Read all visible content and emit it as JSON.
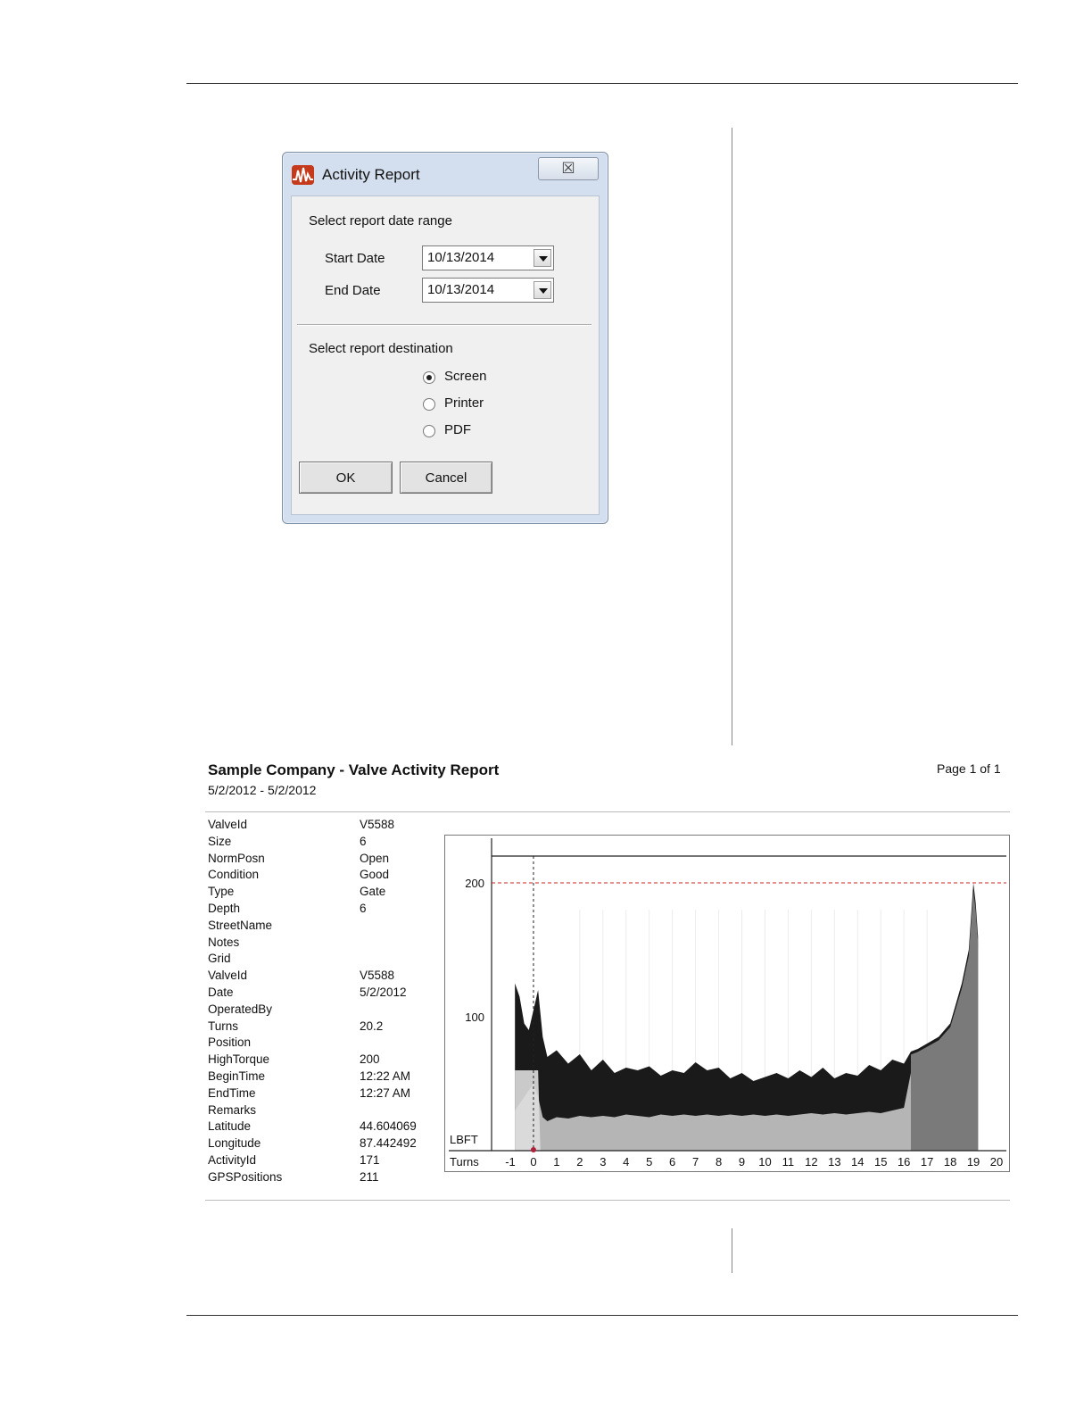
{
  "dialog": {
    "title": "Activity Report",
    "close_glyph": "☒",
    "date_section_label": "Select report date range",
    "start_date_label": "Start Date",
    "start_date_value": "10/13/2014",
    "end_date_label": "End Date",
    "end_date_value": "10/13/2014",
    "destination_section_label": "Select report destination",
    "destinations": [
      {
        "label": "Screen",
        "selected": true
      },
      {
        "label": "Printer",
        "selected": false
      },
      {
        "label": "PDF",
        "selected": false
      }
    ],
    "ok_label": "OK",
    "cancel_label": "Cancel"
  },
  "report": {
    "title": "Sample Company - Valve Activity Report",
    "date_range": "5/2/2012 - 5/2/2012",
    "page_label": "Page 1 of 1",
    "properties": [
      {
        "k": "ValveId",
        "v": "V5588"
      },
      {
        "k": "Size",
        "v": "6"
      },
      {
        "k": "NormPosn",
        "v": "Open"
      },
      {
        "k": "Condition",
        "v": "Good"
      },
      {
        "k": "Type",
        "v": "Gate"
      },
      {
        "k": "Depth",
        "v": "6"
      },
      {
        "k": "StreetName",
        "v": ""
      },
      {
        "k": "Notes",
        "v": ""
      },
      {
        "k": "Grid",
        "v": ""
      },
      {
        "k": "ValveId",
        "v": "V5588"
      },
      {
        "k": "Date",
        "v": "5/2/2012"
      },
      {
        "k": "OperatedBy",
        "v": ""
      },
      {
        "k": "Turns",
        "v": "20.2"
      },
      {
        "k": "Position",
        "v": ""
      },
      {
        "k": "HighTorque",
        "v": "200"
      },
      {
        "k": "BeginTime",
        "v": "12:22 AM"
      },
      {
        "k": "EndTime",
        "v": "12:27 AM"
      },
      {
        "k": "Remarks",
        "v": ""
      },
      {
        "k": "Latitude",
        "v": "44.604069"
      },
      {
        "k": "Longitude",
        "v": "87.442492"
      },
      {
        "k": "ActivityId",
        "v": "171"
      },
      {
        "k": "GPSPositions",
        "v": "211"
      }
    ]
  },
  "chart_data": {
    "type": "area",
    "xlabel": "Turns",
    "ylabel": "LBFT",
    "xlim": [
      -1,
      20
    ],
    "ylim": [
      0,
      220
    ],
    "x_ticks": [
      -1,
      0,
      1,
      2,
      3,
      4,
      5,
      6,
      7,
      8,
      9,
      10,
      11,
      12,
      13,
      14,
      15,
      16,
      17,
      18,
      19,
      20
    ],
    "y_ticks": [
      100,
      200
    ],
    "high_torque_line": 200,
    "marker_x": 0,
    "colors": {
      "upper": "#1a1a1a",
      "lower": "#b5b5b5",
      "start_segment": "#dedede",
      "end_segment": "#7a7a7a",
      "limit_line": "#cc2222"
    },
    "series": [
      {
        "x": [
          -0.8,
          -0.6,
          -0.4,
          -0.2,
          0.0,
          0.2,
          0.4,
          0.6,
          1.0,
          1.5,
          2.0,
          2.5,
          3.0,
          3.5,
          4.0,
          4.5,
          5.0,
          5.5,
          6.0,
          6.5,
          7.0,
          7.5,
          8.0,
          8.5,
          9.0,
          9.5,
          10.0,
          10.5,
          11.0,
          11.5,
          12.0,
          12.5,
          13.0,
          13.5,
          14.0,
          14.5,
          15.0,
          15.5,
          16.0,
          16.3,
          16.6,
          17.0,
          17.5,
          18.0,
          18.5,
          18.8,
          19.0,
          19.1,
          19.2
        ],
        "upper": [
          125,
          115,
          95,
          90,
          105,
          120,
          85,
          70,
          75,
          65,
          72,
          60,
          68,
          58,
          62,
          60,
          63,
          56,
          60,
          58,
          66,
          60,
          62,
          54,
          58,
          52,
          55,
          58,
          54,
          60,
          55,
          62,
          54,
          58,
          56,
          64,
          60,
          68,
          65,
          74,
          76,
          80,
          85,
          95,
          125,
          150,
          200,
          185,
          160
        ],
        "lower": [
          30,
          35,
          40,
          45,
          50,
          40,
          25,
          22,
          25,
          24,
          26,
          25,
          26,
          25,
          27,
          26,
          25,
          27,
          26,
          27,
          26,
          27,
          26,
          27,
          26,
          27,
          26,
          27,
          26,
          27,
          28,
          27,
          28,
          27,
          28,
          29,
          28,
          30,
          32,
          58,
          60,
          62,
          65,
          70,
          85,
          130,
          190,
          175,
          150
        ]
      }
    ]
  }
}
